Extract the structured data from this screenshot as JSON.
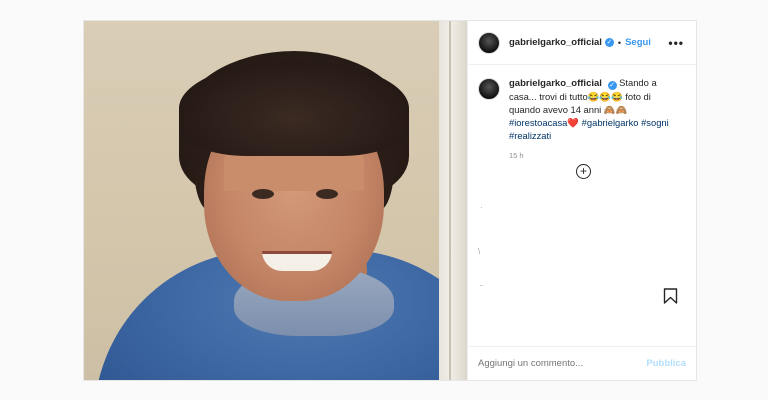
{
  "post": {
    "username": "gabrielgarko_official",
    "verified_icon": "verified-badge-icon",
    "separator": "•",
    "follow_label": "Segui",
    "more_icon": "•••"
  },
  "comment": {
    "username": "gabrielgarko_official",
    "caption_part1": "Stando a casa... trovi di tutto😂😂😂 foto di quando avevo 14 anni 🙈🙈",
    "tag1": "#iorestoacasa",
    "heart": "❤️",
    "tag2": "#gabrielgarko",
    "tag3": "#sogni",
    "tag4": "#realizzati",
    "time": "15 h",
    "load_more_icon": "+"
  },
  "footer": {
    "placeholder": "Aggiungi un commento...",
    "publish_label": "Pubblica"
  },
  "faint_marks": {
    "a": "·",
    "b": "\\",
    "c": "‾"
  },
  "colors": {
    "link": "#3897f0",
    "hashtag": "#003569",
    "publish_disabled": "#b2dffc"
  }
}
